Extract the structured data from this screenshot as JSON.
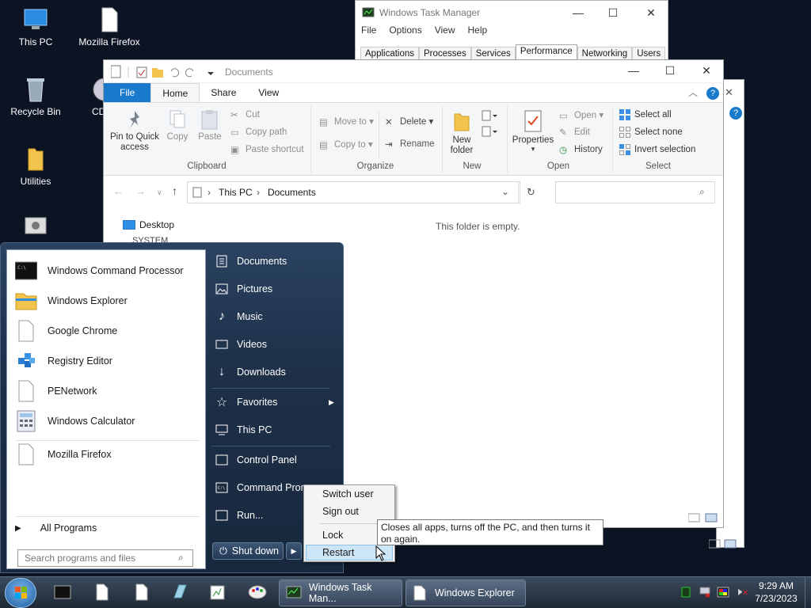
{
  "desktop": {
    "icons": [
      {
        "label": "This PC"
      },
      {
        "label": "Mozilla Firefox"
      },
      {
        "label": "Recycle Bin"
      },
      {
        "label": "CD"
      },
      {
        "label": "Utilities"
      }
    ]
  },
  "task_manager": {
    "title": "Windows Task Manager",
    "menu": [
      "File",
      "Options",
      "View",
      "Help"
    ],
    "tabs": [
      "Applications",
      "Processes",
      "Services",
      "Performance",
      "Networking",
      "Users"
    ],
    "active_tab": "Performance"
  },
  "explorer": {
    "title": "Documents",
    "ribbon_tabs": [
      "File",
      "Home",
      "Share",
      "View"
    ],
    "clipboard": {
      "pin": "Pin to Quick access",
      "copy": "Copy",
      "paste": "Paste",
      "cut": "Cut",
      "copy_path": "Copy path",
      "paste_shortcut": "Paste shortcut",
      "label": "Clipboard"
    },
    "organize": {
      "move_to": "Move to",
      "copy_to": "Copy to",
      "delete": "Delete",
      "rename": "Rename",
      "label": "Organize"
    },
    "new": {
      "new_folder": "New folder",
      "label": "New"
    },
    "open": {
      "properties": "Properties",
      "open": "Open",
      "edit": "Edit",
      "history": "History",
      "label": "Open"
    },
    "select": {
      "select_all": "Select all",
      "select_none": "Select none",
      "invert": "Invert selection",
      "label": "Select"
    },
    "address": {
      "this_pc": "This PC",
      "documents": "Documents"
    },
    "nav": {
      "desktop": "Desktop",
      "system": "SYSTEM"
    },
    "empty_text": "This folder is empty."
  },
  "start_menu": {
    "programs": [
      {
        "label": "Windows Command Processor"
      },
      {
        "label": "Windows Explorer"
      },
      {
        "label": "Google Chrome"
      },
      {
        "label": "Registry Editor"
      },
      {
        "label": "PENetwork"
      },
      {
        "label": "Windows Calculator"
      }
    ],
    "pinned_extra": "Mozilla Firefox",
    "all_programs": "All Programs",
    "search_placeholder": "Search programs and files",
    "right": {
      "documents": "Documents",
      "pictures": "Pictures",
      "music": "Music",
      "videos": "Videos",
      "downloads": "Downloads",
      "favorites": "Favorites",
      "this_pc": "This PC",
      "control_panel": "Control Panel",
      "command_prompt": "Command Prom",
      "run": "Run..."
    },
    "shutdown": "Shut down"
  },
  "shutdown_menu": {
    "switch_user": "Switch user",
    "sign_out": "Sign out",
    "lock": "Lock",
    "restart": "Restart"
  },
  "tooltip": {
    "text": "Closes all apps, turns off the PC, and then turns it on again."
  },
  "taskbar": {
    "task_manager": "Windows Task Man...",
    "explorer": "Windows Explorer",
    "time": "9:29 AM",
    "date": "7/23/2023"
  }
}
